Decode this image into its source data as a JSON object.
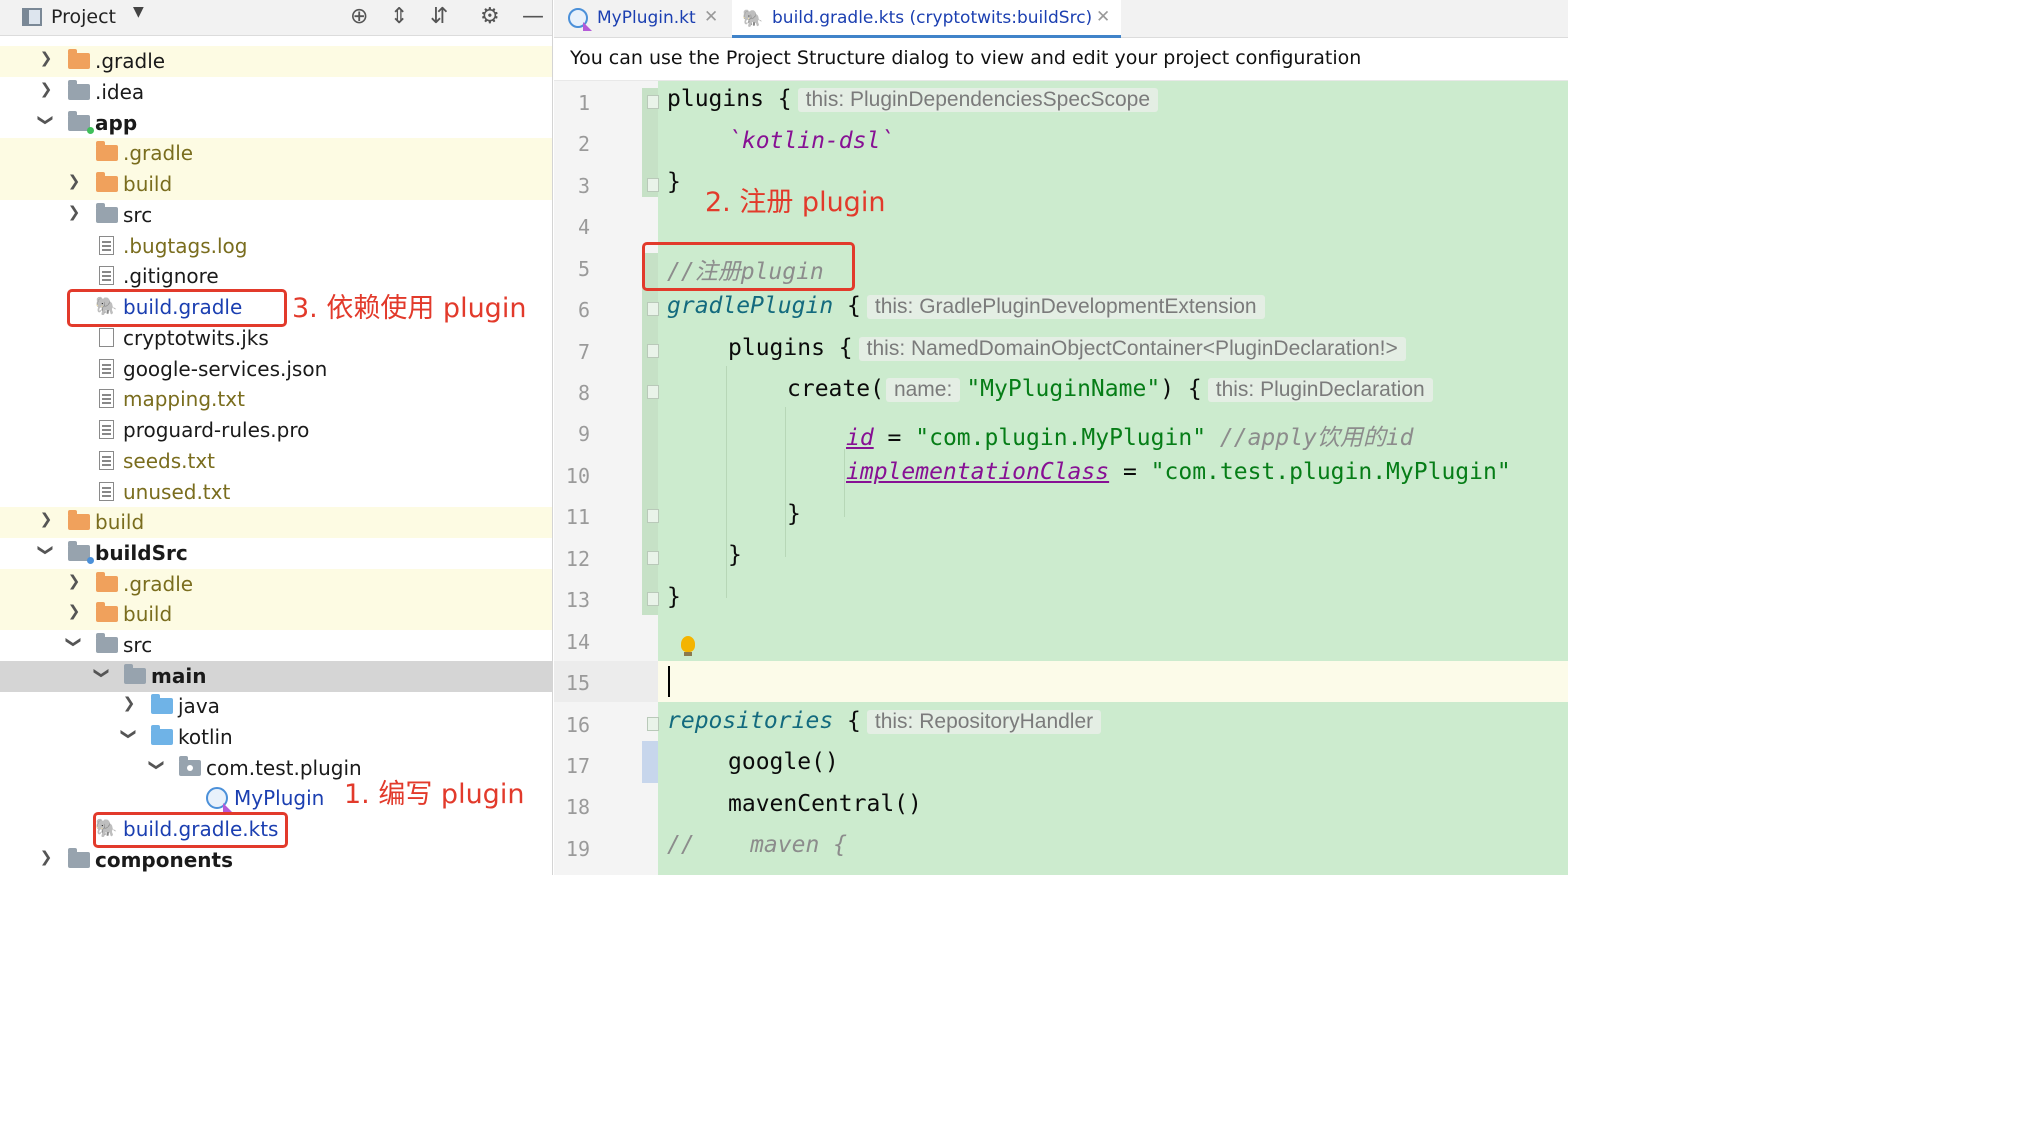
{
  "project_panel": {
    "title": "Project",
    "header_icons": [
      "crosshair-icon",
      "expand-all-icon",
      "collapse-all-icon",
      "gear-icon",
      "minimize-icon"
    ],
    "tree": [
      {
        "label": ".gradle",
        "icon": "folder-orange"
      },
      {
        "label": ".idea",
        "icon": "folder-gray"
      },
      {
        "label": "app",
        "icon": "module-folder"
      },
      {
        "label": ".gradle",
        "icon": "folder-orange"
      },
      {
        "label": "build",
        "icon": "folder-orange"
      },
      {
        "label": "src",
        "icon": "folder-gray"
      },
      {
        "label": ".bugtags.log",
        "icon": "text-file"
      },
      {
        "label": ".gitignore",
        "icon": "ignore-file"
      },
      {
        "label": "build.gradle",
        "icon": "gradle-icon"
      },
      {
        "label": "cryptotwits.jks",
        "icon": "blank-file"
      },
      {
        "label": "google-services.json",
        "icon": "json-file"
      },
      {
        "label": "mapping.txt",
        "icon": "text-file"
      },
      {
        "label": "proguard-rules.pro",
        "icon": "text-file"
      },
      {
        "label": "seeds.txt",
        "icon": "text-file"
      },
      {
        "label": "unused.txt",
        "icon": "text-file"
      },
      {
        "label": "build",
        "icon": "folder-orange"
      },
      {
        "label": "buildSrc",
        "icon": "module-folder"
      },
      {
        "label": ".gradle",
        "icon": "folder-orange"
      },
      {
        "label": "build",
        "icon": "folder-orange"
      },
      {
        "label": "src",
        "icon": "folder-gray"
      },
      {
        "label": "main",
        "icon": "folder-gray"
      },
      {
        "label": "java",
        "icon": "folder-blue"
      },
      {
        "label": "kotlin",
        "icon": "folder-blue"
      },
      {
        "label": "com.test.plugin",
        "icon": "package-icon"
      },
      {
        "label": "MyPlugin",
        "icon": "kotlin-class-icon"
      },
      {
        "label": "build.gradle.kts",
        "icon": "gradle-kts-icon"
      },
      {
        "label": "components",
        "icon": "module-folder"
      }
    ]
  },
  "annotations": {
    "step1": "1. 编写 plugin",
    "step2": "2. 注册 plugin",
    "step3": "3. 依赖使用 plugin"
  },
  "editor": {
    "tabs": [
      {
        "label": "MyPlugin.kt",
        "icon": "kotlin-file-icon",
        "active": false
      },
      {
        "label": "build.gradle.kts (cryptotwits:buildSrc)",
        "icon": "gradle-kts-icon",
        "active": true
      }
    ],
    "notice": "You can use the Project Structure dialog to view and edit your project configuration",
    "line_numbers": [
      "1",
      "2",
      "3",
      "4",
      "5",
      "6",
      "7",
      "8",
      "9",
      "10",
      "11",
      "12",
      "13",
      "14",
      "15",
      "16",
      "17",
      "18",
      "19"
    ],
    "code": {
      "l1_kw": "plugins",
      "l1_brace": " {",
      "l1_hint": "this: PluginDependenciesSpecScope",
      "l2": "`kotlin-dsl`",
      "l3": "}",
      "l5": "//注册plugin",
      "l6_kw": "gradlePlugin",
      "l6_brace": " {",
      "l6_hint": "this: GradlePluginDevelopmentExtension",
      "l7_kw": "plugins",
      "l7_brace": " {",
      "l7_hint": "this: NamedDomainObjectContainer<PluginDeclaration!>",
      "l8_fn": "create(",
      "l8_param_hint": "name:",
      "l8_str": "\"MyPluginName\"",
      "l8_close": ") {",
      "l8_hint": "this: PluginDeclaration",
      "l9_prop": "id",
      "l9_eq": " = ",
      "l9_str": "\"com.plugin.MyPlugin\"",
      "l9_cmt": " //apply饮用的id",
      "l10_prop": "implementationClass",
      "l10_eq": " = ",
      "l10_str": "\"com.test.plugin.MyPlugin\"",
      "l11": "}",
      "l12": "}",
      "l13": "}",
      "l16_kw": "repositories",
      "l16_brace": " {",
      "l16_hint": "this: RepositoryHandler",
      "l17": "google()",
      "l18": "mavenCentral()",
      "l19": "//    maven {"
    }
  },
  "colors": {
    "annotation_red": "#e23a2b",
    "changed_lines_green": "#ccebce",
    "current_line": "#fcfbe9",
    "string_green": "#067d17",
    "property_purple": "#871094",
    "file_link_blue": "#1b3fb1",
    "olive_ignored": "#7a6d1e"
  }
}
